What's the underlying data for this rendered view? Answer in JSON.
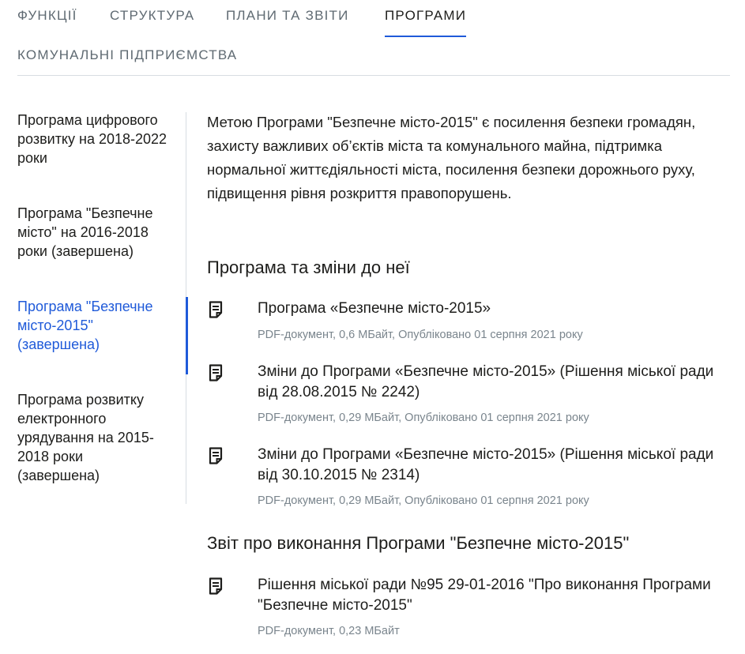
{
  "tabs": [
    {
      "label": "ФУНКЦІЇ"
    },
    {
      "label": "СТРУКТУРА"
    },
    {
      "label": "ПЛАНИ ТА ЗВІТИ"
    },
    {
      "label": "ПРОГРАМИ",
      "active": true
    },
    {
      "label": "КОМУНАЛЬНІ ПІДПРИЄМСТВА"
    }
  ],
  "sidebar": {
    "items": [
      {
        "label": "Програма цифрового розвитку на 2018-2022 роки"
      },
      {
        "label": "Програма \"Безпечне місто\" на 2016-2018 роки (завершена)"
      },
      {
        "label": "Програма \"Безпечне місто-2015\" (завершена)",
        "active": true
      },
      {
        "label": "Програма розвитку електронного урядування на 2015-2018 роки (завершена)"
      }
    ]
  },
  "main": {
    "intro": "Метою Програми \"Безпечне місто-2015\" є посилення безпеки громадян, захисту важливих об’єктів міста та комунального майна, підтримка нормальної життєдіяльності міста, посилення безпеки дорожнього руху, підвищення рівня розкриття правопорушень.",
    "section1_title": "Програма та зміни до неї",
    "section1_docs": [
      {
        "title": "Програма «Безпечне місто-2015»",
        "meta": "PDF-документ, 0,6 МБайт, Опубліковано 01 серпня 2021 року"
      },
      {
        "title": "Зміни до Програми «Безпечне місто-2015» (Рішення міської ради від 28.08.2015 № 2242)",
        "meta": "PDF-документ, 0,29 МБайт, Опубліковано 01 серпня 2021 року"
      },
      {
        "title": "Зміни до Програми «Безпечне місто-2015» (Рішення міської ради від 30.10.2015 № 2314)",
        "meta": "PDF-документ, 0,29 МБайт, Опубліковано 01 серпня 2021 року"
      }
    ],
    "section2_title": "Звіт про виконання Програми \"Безпечне місто-2015\"",
    "section2_docs": [
      {
        "title": "Рішення міської ради №95 29-01-2016 \"Про виконання Програми \"Безпечне місто-2015\"",
        "meta": "PDF-документ, 0,23 МБайт"
      }
    ]
  },
  "colors": {
    "accent": "#1f5ad9",
    "text": "#1d1d1b",
    "muted": "#7a858d",
    "divider": "#d7dde2"
  },
  "icons": {
    "document": "document-icon"
  }
}
